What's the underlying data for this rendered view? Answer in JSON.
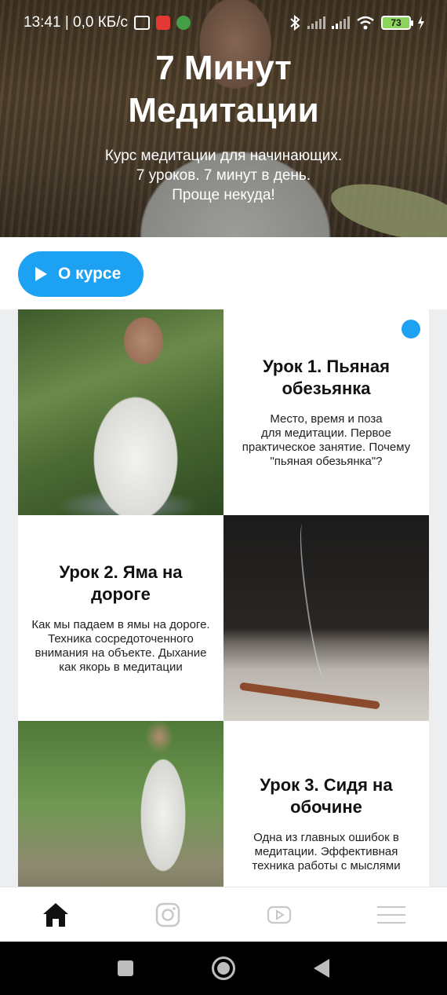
{
  "status_bar": {
    "time_and_speed": "13:41 | 0,0 КБ/с",
    "battery": "73"
  },
  "hero": {
    "title_line1": "7 Минут",
    "title_line2": "Медитации",
    "subtitle_line1": "Курс медитации для начинающих.",
    "subtitle_line2": "7 уроков. 7 минут в день.",
    "subtitle_line3": "Проще некуда!"
  },
  "about_button": {
    "label": "О курсе"
  },
  "lessons": [
    {
      "title_line1": "Урок 1. Пьяная",
      "title_line2": "обезьянка",
      "desc": [
        "Место, время и поза",
        "для медитации. Первое",
        "практическое занятие. Почему",
        "\"пьяная обезьянка\"?"
      ]
    },
    {
      "title_line1": "Урок 2. Яма на дороге",
      "desc": [
        "Как мы падаем в ямы на дороге.",
        "Техника сосредоточенного",
        "внимания на объекте. Дыхание",
        "как якорь в медитации"
      ]
    },
    {
      "title_line1": "Урок 3. Сидя на",
      "title_line2": "обочине",
      "desc": [
        "Одна из главных ошибок в",
        "медитации. Эффективная",
        "техника работы с мыслями"
      ]
    }
  ],
  "icons": {
    "home": "home-icon",
    "instagram": "instagram-icon",
    "youtube": "youtube-icon",
    "menu": "menu-icon"
  },
  "colors": {
    "accent": "#1da1f2",
    "grid_background": "#eceef0",
    "nav_active": "#111111",
    "nav_inactive": "#c8c8c8"
  }
}
